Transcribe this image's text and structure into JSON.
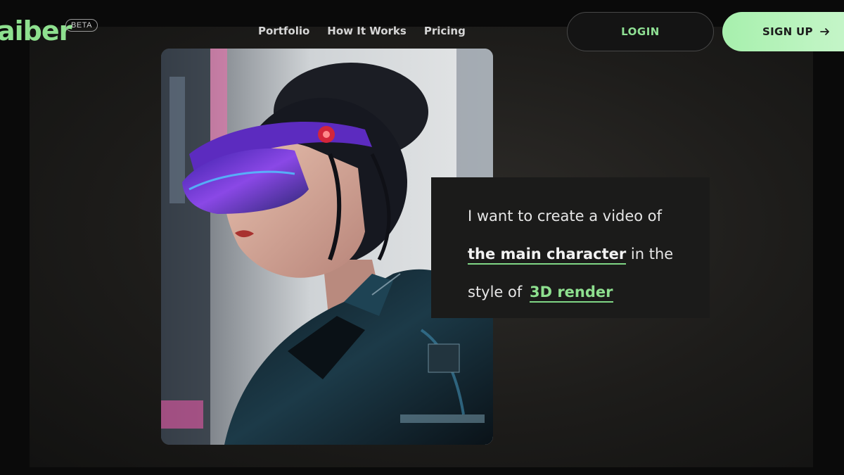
{
  "brand": {
    "name": "aiber",
    "badge": "BETA",
    "accent": "#8ee08f"
  },
  "nav": {
    "items": [
      {
        "label": "Portfolio"
      },
      {
        "label": "How It Works"
      },
      {
        "label": "Pricing"
      }
    ]
  },
  "auth": {
    "login_label": "LOGIN",
    "signup_label": "SIGN UP",
    "signup_icon": "arrow-right-icon"
  },
  "hero": {
    "image_alt": "cyberpunk-woman-with-visor",
    "prompt": {
      "line1": "I want to create a video of",
      "subject": "the main character",
      "line2_rest": " in the",
      "line3_prefix": "style of",
      "style": "3D render"
    }
  }
}
